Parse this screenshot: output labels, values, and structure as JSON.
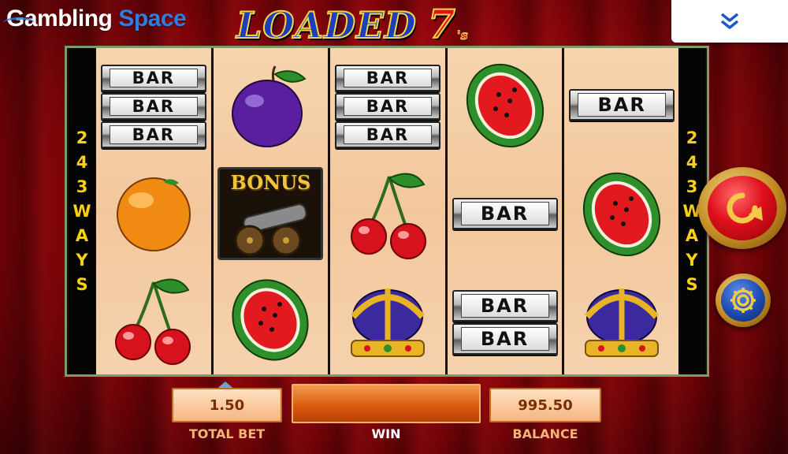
{
  "brand": {
    "part1": "Gambling",
    "part2": "Space"
  },
  "game": {
    "title": "LOADED",
    "sevens": "7",
    "suffix": "'s"
  },
  "ways": {
    "left": [
      "2",
      "4",
      "3",
      "W",
      "A",
      "Y",
      "S"
    ],
    "right": [
      "2",
      "4",
      "3",
      "W",
      "A",
      "Y",
      "S"
    ]
  },
  "reels": [
    [
      {
        "symbol": "triple-bar",
        "labels": [
          "BAR",
          "BAR",
          "BAR"
        ]
      },
      {
        "symbol": "orange"
      },
      {
        "symbol": "cherries"
      }
    ],
    [
      {
        "symbol": "plum"
      },
      {
        "symbol": "bonus-cannon",
        "label": "BONUS"
      },
      {
        "symbol": "watermelon"
      }
    ],
    [
      {
        "symbol": "triple-bar",
        "labels": [
          "BAR",
          "BAR",
          "BAR"
        ]
      },
      {
        "symbol": "cherries"
      },
      {
        "symbol": "crown"
      }
    ],
    [
      {
        "symbol": "watermelon"
      },
      {
        "symbol": "single-bar",
        "labels": [
          "BAR"
        ]
      },
      {
        "symbol": "double-bar",
        "labels": [
          "BAR",
          "BAR"
        ]
      }
    ],
    [
      {
        "symbol": "single-bar",
        "labels": [
          "BAR"
        ]
      },
      {
        "symbol": "watermelon"
      },
      {
        "symbol": "crown"
      }
    ]
  ],
  "panel": {
    "total_bet_value": "1.50",
    "total_bet_label": "TOTAL BET",
    "win_value": "",
    "win_label": "WIN",
    "balance_value": "995.50",
    "balance_label": "BALANCE"
  },
  "controls": {
    "menu_icon": "chevron-double-down-icon",
    "spin_icon": "spin-arrow-icon",
    "settings_icon": "gear-icon"
  },
  "colors": {
    "background": "#a1060d",
    "reel_bg": "#f3c79c",
    "ways_text": "#f8d018",
    "panel_text": "#7a2d05",
    "win_box": "#d8560a",
    "accent_blue": "#2f7de1"
  }
}
